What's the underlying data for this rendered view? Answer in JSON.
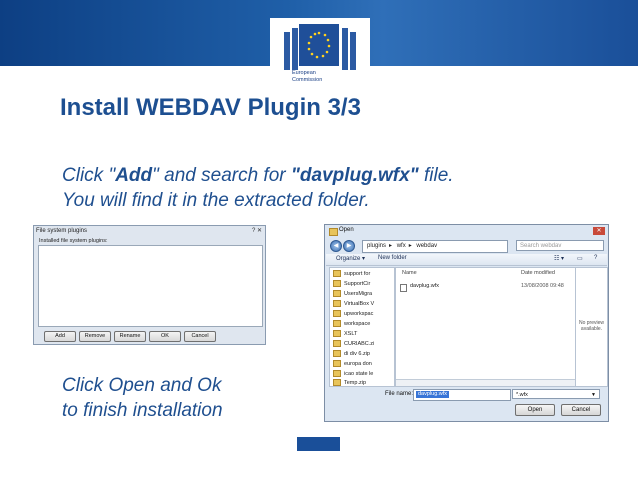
{
  "logo": {
    "line1": "European",
    "line2": "Commission"
  },
  "title": "Install WEBDAV Plugin 3/3",
  "instructions1": {
    "p1": "Click \"",
    "b1": "Add",
    "p2": "\" and search for ",
    "b2": "\"davplug.wfx\"",
    "p3": " file.",
    "line2": "You will find it in the extracted folder."
  },
  "instructions2": {
    "line1": "Click Open and Ok",
    "line2": "to finish installation"
  },
  "plugins_dialog": {
    "title": "File system plugins",
    "list_label": "Installed file system plugins:",
    "buttons": [
      "Add",
      "Remove",
      "Rename",
      "OK",
      "Cancel"
    ]
  },
  "open_dialog": {
    "title": "Open",
    "path": [
      "plugins",
      "wfx",
      "webdav"
    ],
    "search_placeholder": "Search webdav",
    "organize": "Organize ▾",
    "new_folder": "New folder",
    "tree": [
      "support for",
      "SupportCir",
      "UsersMigra",
      "VirtualBox V",
      "upworkspac",
      "workspace",
      "XSLT",
      "CURIABC.zi",
      "di div 6.zip",
      "europa don",
      "icao state le",
      "Temp.zip"
    ],
    "columns": {
      "name": "Name",
      "date_modified": "Date modified"
    },
    "files": [
      {
        "name": "davplug.wfx",
        "date": "13/08/2008 09:48"
      }
    ],
    "preview_text": "No preview available.",
    "file_name_label": "File name:",
    "file_name_value": "davplug.wfx",
    "file_type_value": "*.wfx",
    "open_button": "Open",
    "cancel_button": "Cancel"
  },
  "colors": {
    "banner": "#1f5fa8",
    "title": "#1d4f91",
    "text": "#1f4f8f"
  }
}
